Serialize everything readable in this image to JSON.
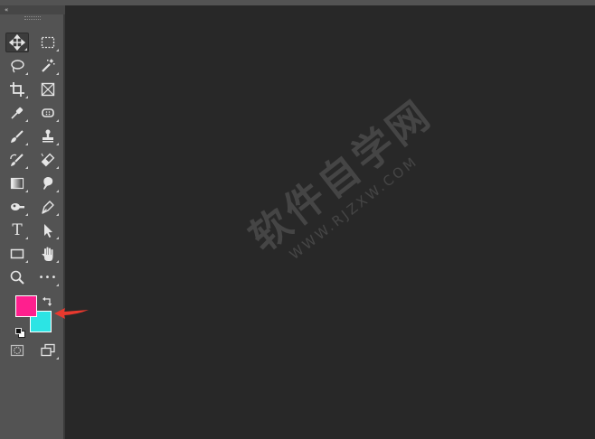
{
  "toolbar": {
    "collapse_glyph": "«",
    "tools": [
      {
        "name": "move-tool",
        "icon": "move-icon",
        "active": true
      },
      {
        "name": "marquee-tool",
        "icon": "rect-marquee-icon"
      },
      {
        "name": "lasso-tool",
        "icon": "lasso-icon"
      },
      {
        "name": "magic-wand-tool",
        "icon": "magic-wand-icon"
      },
      {
        "name": "crop-tool",
        "icon": "crop-icon"
      },
      {
        "name": "frame-tool",
        "icon": "frame-icon"
      },
      {
        "name": "eyedropper-tool",
        "icon": "eyedropper-icon"
      },
      {
        "name": "spot-healing-tool",
        "icon": "healing-icon"
      },
      {
        "name": "brush-tool",
        "icon": "brush-icon"
      },
      {
        "name": "clone-stamp-tool",
        "icon": "stamp-icon"
      },
      {
        "name": "history-brush-tool",
        "icon": "history-brush-icon"
      },
      {
        "name": "eraser-tool",
        "icon": "eraser-icon"
      },
      {
        "name": "gradient-tool",
        "icon": "gradient-icon"
      },
      {
        "name": "blur-tool",
        "icon": "blur-icon"
      },
      {
        "name": "dodge-tool",
        "icon": "dodge-icon"
      },
      {
        "name": "pen-tool",
        "icon": "pen-icon"
      },
      {
        "name": "type-tool",
        "icon": "type-icon"
      },
      {
        "name": "path-selection-tool",
        "icon": "arrow-cursor-icon"
      },
      {
        "name": "rectangle-tool",
        "icon": "rectangle-icon"
      },
      {
        "name": "hand-tool",
        "icon": "hand-icon"
      },
      {
        "name": "zoom-tool",
        "icon": "magnifier-icon"
      },
      {
        "name": "more-tools",
        "icon": "ellipsis-icon"
      }
    ],
    "type_tool_glyph": "T",
    "more_glyph": "•••",
    "foreground_color": "#ff1f8e",
    "background_color": "#2ce4e4"
  },
  "annotation": {
    "arrow_color": "#e8392e"
  },
  "watermark": {
    "text": "软件自学网",
    "url": "WWW.RJZXW.COM"
  }
}
